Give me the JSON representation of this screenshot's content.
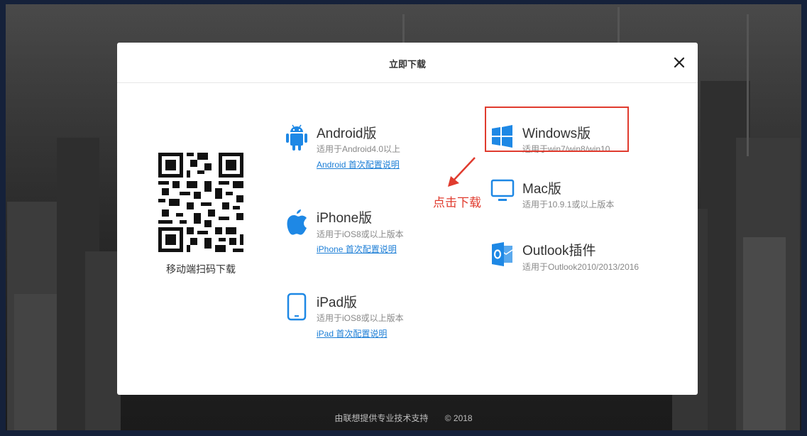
{
  "modal": {
    "title": "立即下载",
    "qr_caption": "移动端扫码下载"
  },
  "downloads": {
    "android": {
      "name": "Android版",
      "desc": "适用于Android4.0以上",
      "link": "Android 首次配置说明",
      "icon": "android-icon"
    },
    "iphone": {
      "name": "iPhone版",
      "desc": "适用于iOS8或以上版本",
      "link": "iPhone 首次配置说明",
      "icon": "apple-icon"
    },
    "ipad": {
      "name": "iPad版",
      "desc": "适用于iOS8或以上版本",
      "link": "iPad 首次配置说明",
      "icon": "tablet-icon"
    },
    "windows": {
      "name": "Windows版",
      "desc": "适用于win7/win8/win10",
      "icon": "windows-icon"
    },
    "mac": {
      "name": "Mac版",
      "desc": "适用于10.9.1或以上版本",
      "icon": "monitor-icon"
    },
    "outlook": {
      "name": "Outlook插件",
      "desc": "适用于Outlook2010/2013/2016",
      "icon": "outlook-icon"
    }
  },
  "annotation": {
    "text": "点击下载",
    "color": "#e03b2e"
  },
  "footer": {
    "text": "由联想提供专业技术支持",
    "copyright": "© 2018"
  },
  "colors": {
    "accent": "#1c7ed6",
    "icon_blue": "#1e88e5"
  }
}
